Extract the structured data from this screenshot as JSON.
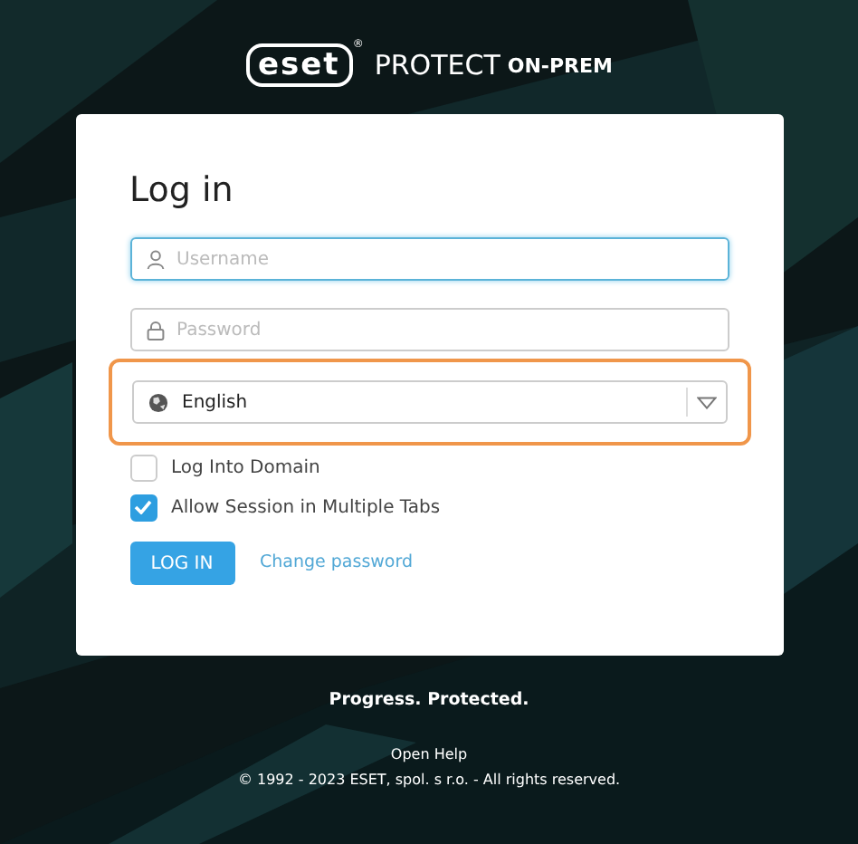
{
  "header": {
    "logo": "eset",
    "logo_mark": "®",
    "product": "PROTECT",
    "edition": "ON-PREM"
  },
  "login": {
    "title": "Log in",
    "username": {
      "placeholder": "Username",
      "focused": true
    },
    "password": {
      "placeholder": "Password"
    },
    "language": {
      "value": "English",
      "highlighted": true
    },
    "checkboxes": [
      {
        "label": "Log Into Domain",
        "checked": false
      },
      {
        "label": "Allow Session in Multiple Tabs",
        "checked": true
      }
    ],
    "buttons": [
      {
        "label": "LOG IN",
        "kind": "primary"
      },
      {
        "label": "Change password",
        "kind": "link"
      }
    ]
  },
  "footer": {
    "tagline": "Progress. Protected.",
    "help_link": "Open Help",
    "copyright": "© 1992 - 2023 ESET, spol. s r.o. - All rights reserved."
  }
}
